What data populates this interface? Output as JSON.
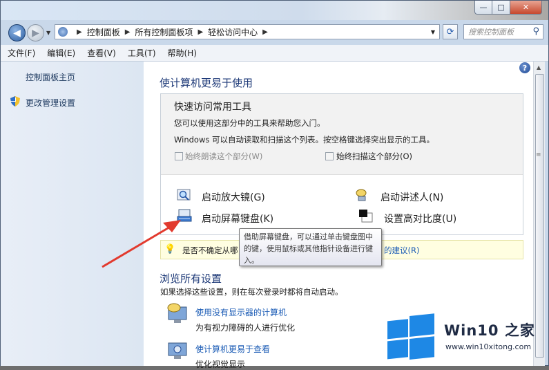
{
  "window": {
    "controls": {
      "minimize": "—",
      "maximize": "□",
      "close": "✕"
    }
  },
  "address": {
    "crumbs": [
      "控制面板",
      "所有控制面板项",
      "轻松访问中心"
    ],
    "search_placeholder": "搜索控制面板"
  },
  "menu": [
    "文件(F)",
    "编辑(E)",
    "查看(V)",
    "工具(T)",
    "帮助(H)"
  ],
  "sidebar": {
    "home": "控制面板主页",
    "admin": "更改管理设置"
  },
  "main": {
    "title": "使计算机更易于使用",
    "quick_access": {
      "title": "快速访问常用工具",
      "desc1": "您可以使用这部分中的工具来帮助您入门。",
      "desc2": "Windows 可以自动读取和扫描这个列表。按空格键选择突出显示的工具。",
      "always_read": "始终朗读这个部分(W)",
      "always_scan": "始终扫描这个部分(O)",
      "tools": {
        "magnifier": "启动放大镜(G)",
        "narrator": "启动讲述人(N)",
        "osk": "启动屏幕键盘(K)",
        "contrast": "设置高对比度(U)"
      }
    },
    "hint": {
      "text": "是否不确定从哪",
      "link": "的建议(R)"
    },
    "tooltip": "借助屏幕键盘，可以通过单击键盘图中的键，使用鼠标或其他指针设备进行键入。",
    "browse": {
      "title": "浏览所有设置",
      "subtitle": "如果选择这些设置，则在每次登录时都将自动启动。",
      "items": [
        {
          "link": "使用没有显示器的计算机",
          "desc": "为有视力障碍的人进行优化"
        },
        {
          "link": "使计算机更易于查看",
          "desc": "优化视觉显示"
        }
      ]
    }
  },
  "watermark": {
    "brand": "Win10 之家",
    "url": "www.win10xitong.com"
  },
  "icons": {
    "help": "help-icon",
    "shield": "shield-icon",
    "bulb": "lightbulb-icon"
  },
  "colors": {
    "link": "#1a5bb5",
    "heading": "#1e3a78",
    "arrow": "#e23a2e"
  }
}
